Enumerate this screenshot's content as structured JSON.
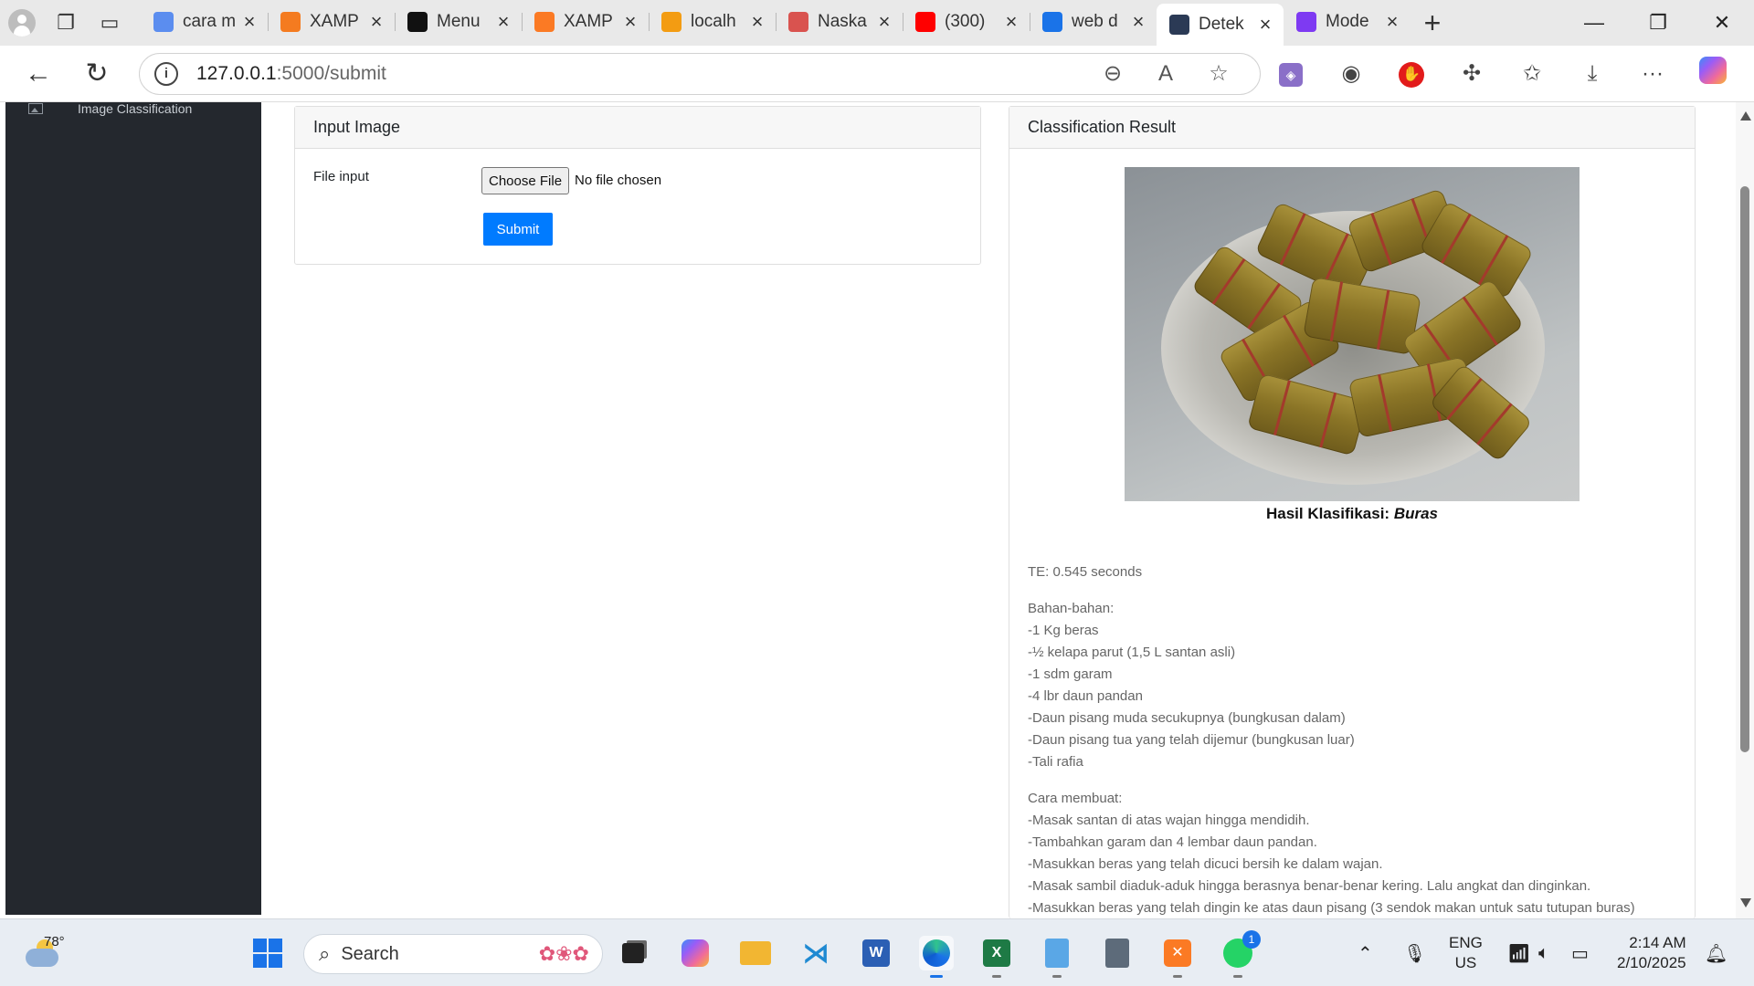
{
  "browser": {
    "tabs": [
      {
        "title": "cara m",
        "favicon": "search-icon",
        "color": "#5b8def"
      },
      {
        "title": "XAMP",
        "favicon": "diamond-icon",
        "color": "#f47b20"
      },
      {
        "title": "Menu",
        "favicon": "openai-icon",
        "color": "#111111"
      },
      {
        "title": "XAMP",
        "favicon": "xampp-icon",
        "color": "#fb7a24"
      },
      {
        "title": "localh",
        "favicon": "phpmyadmin-icon",
        "color": "#f39c12"
      },
      {
        "title": "Naska",
        "favicon": "pdf-icon",
        "color": "#d9534f"
      },
      {
        "title": "(300)",
        "favicon": "youtube-icon",
        "color": "#ff0000"
      },
      {
        "title": "web d",
        "favicon": "search-icon",
        "color": "#1a73e8"
      },
      {
        "title": "Detek",
        "favicon": "terminal-icon",
        "color": "#2b3a55",
        "active": true
      },
      {
        "title": "Mode",
        "favicon": "edge-profile-icon",
        "color": "#7e3af2"
      }
    ],
    "url_host": "127.0.0.1",
    "url_path": ":5000/submit"
  },
  "sidebar": {
    "items": [
      {
        "label": "Image Classification",
        "icon": "image-icon"
      }
    ]
  },
  "input_card": {
    "title": "Input Image",
    "file_label": "File input",
    "choose_button": "Choose File",
    "file_status": "No file chosen",
    "submit_button": "Submit"
  },
  "result_card": {
    "title": "Classification Result",
    "caption_prefix": "Hasil Klasifikasi:",
    "caption_result": "Buras",
    "te": "TE: 0.545 seconds",
    "ingredients": [
      "Bahan-bahan:",
      "-1 Kg beras",
      "-½ kelapa parut (1,5 L santan asli)",
      "-1 sdm garam",
      "-4 lbr daun pandan",
      "-Daun pisang muda secukupnya (bungkusan dalam)",
      "-Daun pisang tua yang telah dijemur (bungkusan luar)",
      "-Tali rafia"
    ],
    "steps": [
      "Cara membuat:",
      "-Masak santan di atas wajan hingga mendidih.",
      "-Tambahkan garam dan 4 lembar daun pandan.",
      "-Masukkan beras yang telah dicuci bersih ke dalam wajan.",
      "-Masak sambil diaduk-aduk hingga berasnya benar-benar kering. Lalu angkat dan dinginkan.",
      "-Masukkan beras yang telah dingin ke atas daun pisang (3 sendok makan untuk satu tutupan buras)"
    ]
  },
  "taskbar": {
    "temperature": "78°",
    "search_placeholder": "Search",
    "language_line1": "ENG",
    "language_line2": "US",
    "time": "2:14 AM",
    "date": "2/10/2025",
    "whatsapp_badge": "1"
  }
}
